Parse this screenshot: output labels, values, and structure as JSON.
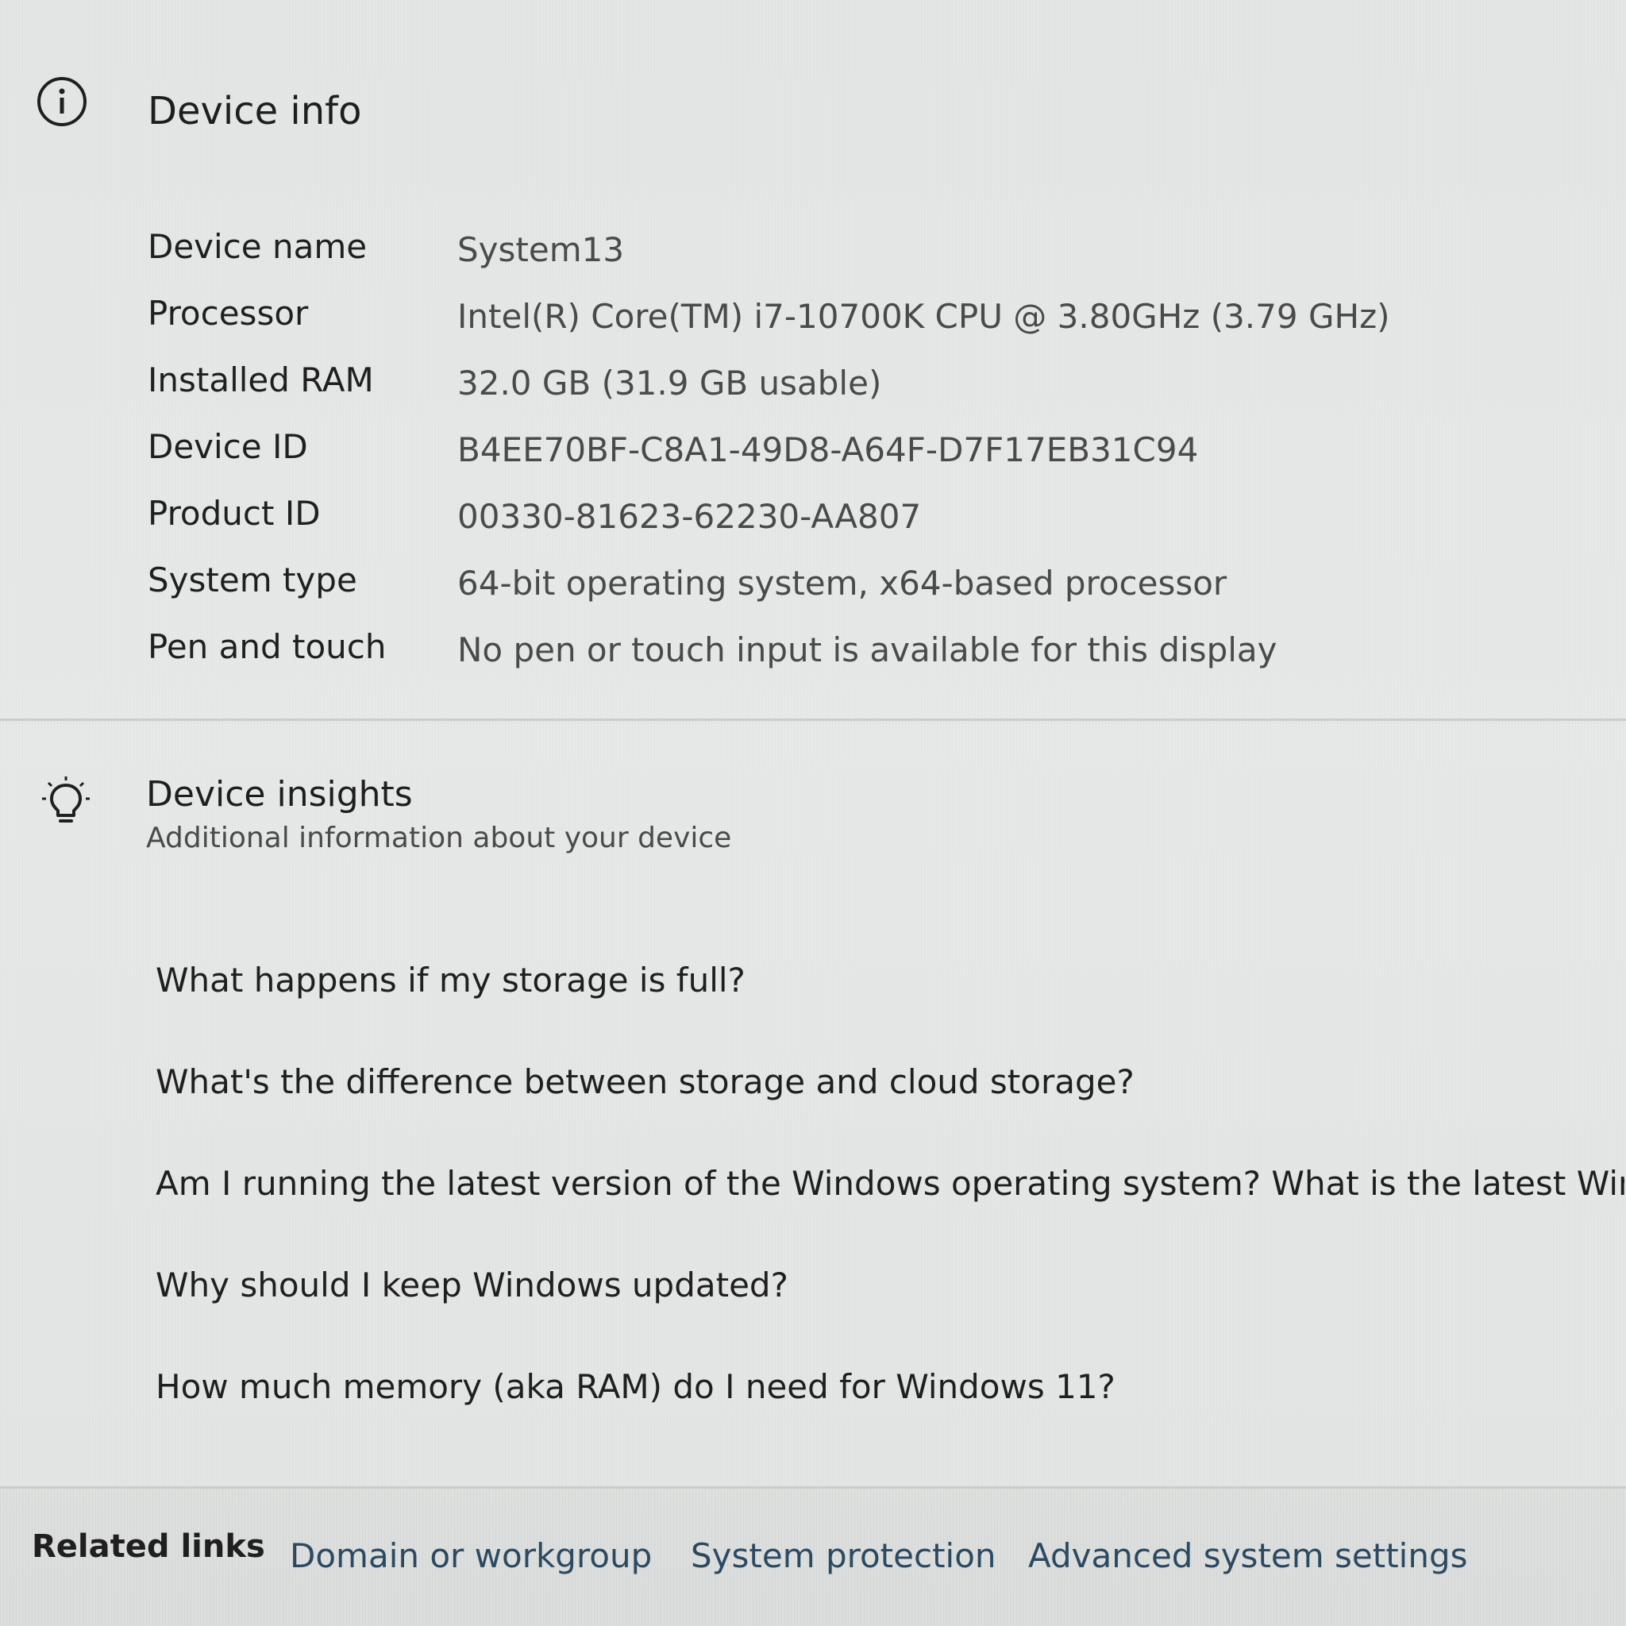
{
  "device_info": {
    "title": "Device info",
    "icon": "info-icon",
    "specs": [
      {
        "label": "Device name",
        "value": "System13"
      },
      {
        "label": "Processor",
        "value": "Intel(R) Core(TM) i7-10700K CPU @ 3.80GHz (3.79 GHz)"
      },
      {
        "label": "Installed RAM",
        "value": "32.0 GB (31.9 GB usable)"
      },
      {
        "label": "Device ID",
        "value": "B4EE70BF-C8A1-49D8-A64F-D7F17EB31C94"
      },
      {
        "label": "Product ID",
        "value": "00330-81623-62230-AA807"
      },
      {
        "label": "System type",
        "value": "64-bit operating system, x64-based processor"
      },
      {
        "label": "Pen and touch",
        "value": "No pen or touch input is available for this display"
      }
    ]
  },
  "device_insights": {
    "title": "Device insights",
    "subtitle": "Additional information about your device",
    "icon": "lightbulb-icon",
    "questions": [
      "What happens if my storage is full?",
      "What's the difference between storage and cloud storage?",
      "Am I running the latest version of the Windows operating system? What is the latest Window",
      "Why should I keep Windows updated?",
      "How much memory (aka RAM) do I need for Windows 11?"
    ]
  },
  "related_links": {
    "label": "Related links",
    "links": [
      "Domain or workgroup",
      "System protection",
      "Advanced system settings"
    ]
  }
}
